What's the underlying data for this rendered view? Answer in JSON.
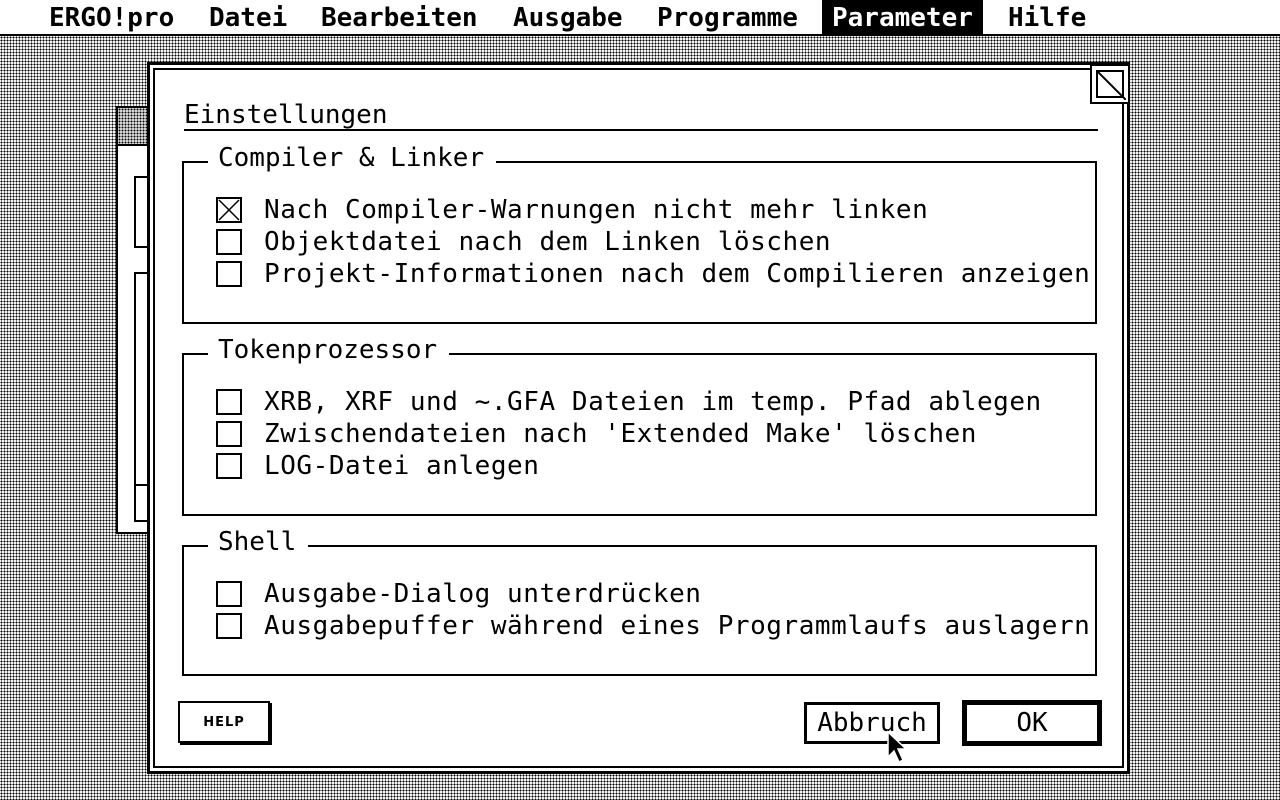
{
  "menubar": {
    "items": [
      {
        "label": "ERGO!pro",
        "active": false
      },
      {
        "label": "Datei",
        "active": false
      },
      {
        "label": "Bearbeiten",
        "active": false
      },
      {
        "label": "Ausgabe",
        "active": false
      },
      {
        "label": "Programme",
        "active": false
      },
      {
        "label": "Parameter",
        "active": true
      },
      {
        "label": "Hilfe",
        "active": false
      }
    ]
  },
  "dialog": {
    "title": "Einstellungen",
    "groups": [
      {
        "label": "Compiler & Linker",
        "options": [
          {
            "label": "Nach Compiler-Warnungen nicht mehr linken",
            "checked": true
          },
          {
            "label": "Objektdatei nach dem Linken löschen",
            "checked": false
          },
          {
            "label": "Projekt-Informationen nach dem Compilieren anzeigen",
            "checked": false
          }
        ]
      },
      {
        "label": "Tokenprozessor",
        "options": [
          {
            "label": "XRB, XRF und ~.GFA Dateien im temp. Pfad ablegen",
            "checked": false
          },
          {
            "label": "Zwischendateien nach 'Extended Make' löschen",
            "checked": false
          },
          {
            "label": "LOG-Datei anlegen",
            "checked": false
          }
        ]
      },
      {
        "label": "Shell",
        "options": [
          {
            "label": "Ausgabe-Dialog unterdrücken",
            "checked": false
          },
          {
            "label": "Ausgabepuffer während eines Programmlaufs auslagern",
            "checked": false
          }
        ]
      }
    ],
    "buttons": {
      "help": "HELP",
      "cancel": "Abbruch",
      "ok": "OK"
    }
  },
  "icons": {
    "closer": "close-box-icon",
    "checkbox_mark": "x-mark-icon",
    "cursor": "mouse-pointer-icon"
  }
}
